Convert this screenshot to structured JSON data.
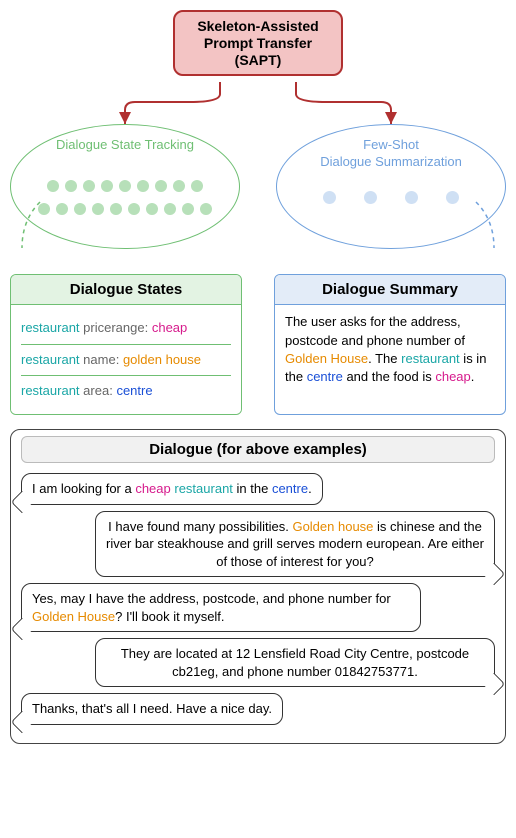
{
  "sapt": {
    "line1": "Skeleton-Assisted",
    "line2": "Prompt Transfer",
    "line3": "(SAPT)"
  },
  "ellipses": {
    "left_label": "Dialogue State Tracking",
    "right_line1": "Few-Shot",
    "right_line2": "Dialogue Summarization"
  },
  "panels": {
    "left": {
      "title": "Dialogue States",
      "rows": [
        {
          "domain": "restaurant",
          "slot": "pricerange",
          "value": "cheap",
          "value_color": "magenta"
        },
        {
          "domain": "restaurant",
          "slot": "name",
          "value": "golden house",
          "value_color": "orange"
        },
        {
          "domain": "restaurant",
          "slot": "area",
          "value": "centre",
          "value_color": "blue"
        }
      ]
    },
    "right": {
      "title": "Dialogue Summary",
      "summary_parts": {
        "p1": "The user asks for the address, postcode and phone number of ",
        "gh": "Golden House",
        "p2": ". The ",
        "rest": "restaurant",
        "p3": " is in the ",
        "centre": "centre",
        "p4": " and the food is ",
        "cheap": "cheap",
        "p5": "."
      }
    }
  },
  "dialogue": {
    "title": "Dialogue (for above examples)",
    "turns": [
      {
        "side": "left",
        "parts": {
          "a": "I am looking for a ",
          "cheap": "cheap",
          " ": " ",
          "rest": "restaurant",
          "b": " in the ",
          "centre": "centre",
          "c": "."
        }
      },
      {
        "side": "right",
        "parts": {
          "a": "I have found many possibilities. ",
          "gh": "Golden house",
          "b": " is chinese and the river bar steakhouse and grill serves modern european. Are either of those of interest for you?"
        }
      },
      {
        "side": "left",
        "parts": {
          "a": "Yes, may I have the address, postcode, and phone number for ",
          "gh": "Golden House",
          "b": "? I'll book it myself."
        }
      },
      {
        "side": "right",
        "parts": {
          "a": "They are located at 12 Lensfield Road City Centre, postcode cb21eg, and phone number 01842753771."
        }
      },
      {
        "side": "left",
        "parts": {
          "a": "Thanks, that's all I need. Have a nice day."
        }
      }
    ]
  },
  "colors": {
    "teal": "#1aa6a6",
    "magenta": "#d61a8c",
    "orange": "#e68a00",
    "olive": "#8a8a2e",
    "blue": "#1a4fd6"
  }
}
